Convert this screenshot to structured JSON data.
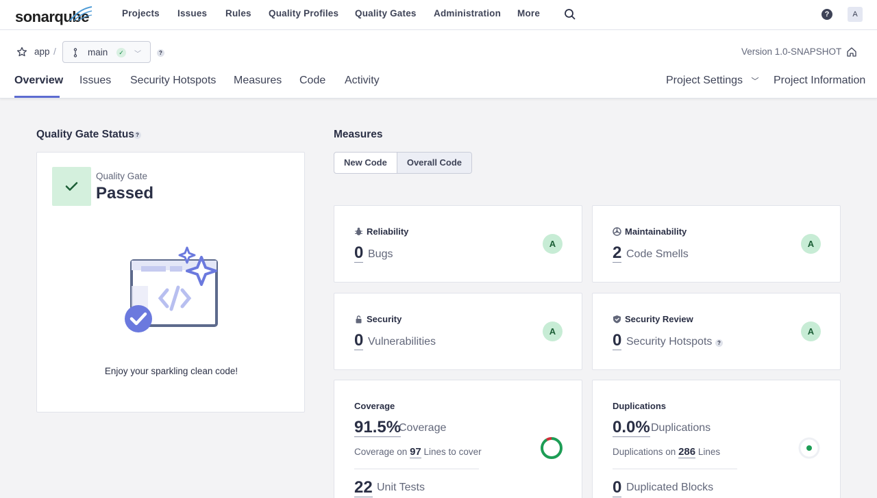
{
  "topnav": {
    "logo": "sonarqube",
    "items": [
      "Projects",
      "Issues",
      "Rules",
      "Quality Profiles",
      "Quality Gates",
      "Administration",
      "More"
    ],
    "help": "?",
    "avatar": "A"
  },
  "project": {
    "name": "app",
    "separator": "/",
    "branch": "main",
    "branch_status": "✓",
    "help": "?",
    "version": "Version 1.0-SNAPSHOT"
  },
  "tabs": [
    "Overview",
    "Issues",
    "Security Hotspots",
    "Measures",
    "Code",
    "Activity"
  ],
  "tabs_right": [
    "Project Settings",
    "Project Information"
  ],
  "quality_gate": {
    "heading": "Quality Gate Status",
    "help": "?",
    "label": "Quality Gate",
    "status": "Passed",
    "message": "Enjoy your sparkling clean code!"
  },
  "measures": {
    "heading": "Measures",
    "segments": [
      "New Code",
      "Overall Code"
    ],
    "selected": "Overall Code",
    "reliability": {
      "title": "Reliability",
      "value": "0",
      "label": "Bugs",
      "rating": "A"
    },
    "maintainability": {
      "title": "Maintainability",
      "value": "2",
      "label": "Code Smells",
      "rating": "A"
    },
    "security": {
      "title": "Security",
      "value": "0",
      "label": "Vulnerabilities",
      "rating": "A"
    },
    "security_review": {
      "title": "Security Review",
      "value": "0",
      "label": "Security Hotspots",
      "help": "?",
      "rating": "A"
    },
    "coverage": {
      "title": "Coverage",
      "value": "91.5%",
      "label": "Coverage",
      "sub_prefix": "Coverage on",
      "lines": "97",
      "sub_suffix": "Lines to cover",
      "unit_tests": "22",
      "unit_tests_label": "Unit Tests",
      "percent": 91.5
    },
    "duplications": {
      "title": "Duplications",
      "value": "0.0%",
      "label": "Duplications",
      "sub_prefix": "Duplications on",
      "lines": "286",
      "sub_suffix": "Lines",
      "blocks": "0",
      "blocks_label": "Duplicated Blocks"
    }
  },
  "colors": {
    "accent": "#5d6cd0",
    "pass_bg": "#d4f0dd",
    "rating_a": "#c7ecd5",
    "coverage_good": "#1d9d55",
    "coverage_bad": "#d02f3a"
  }
}
